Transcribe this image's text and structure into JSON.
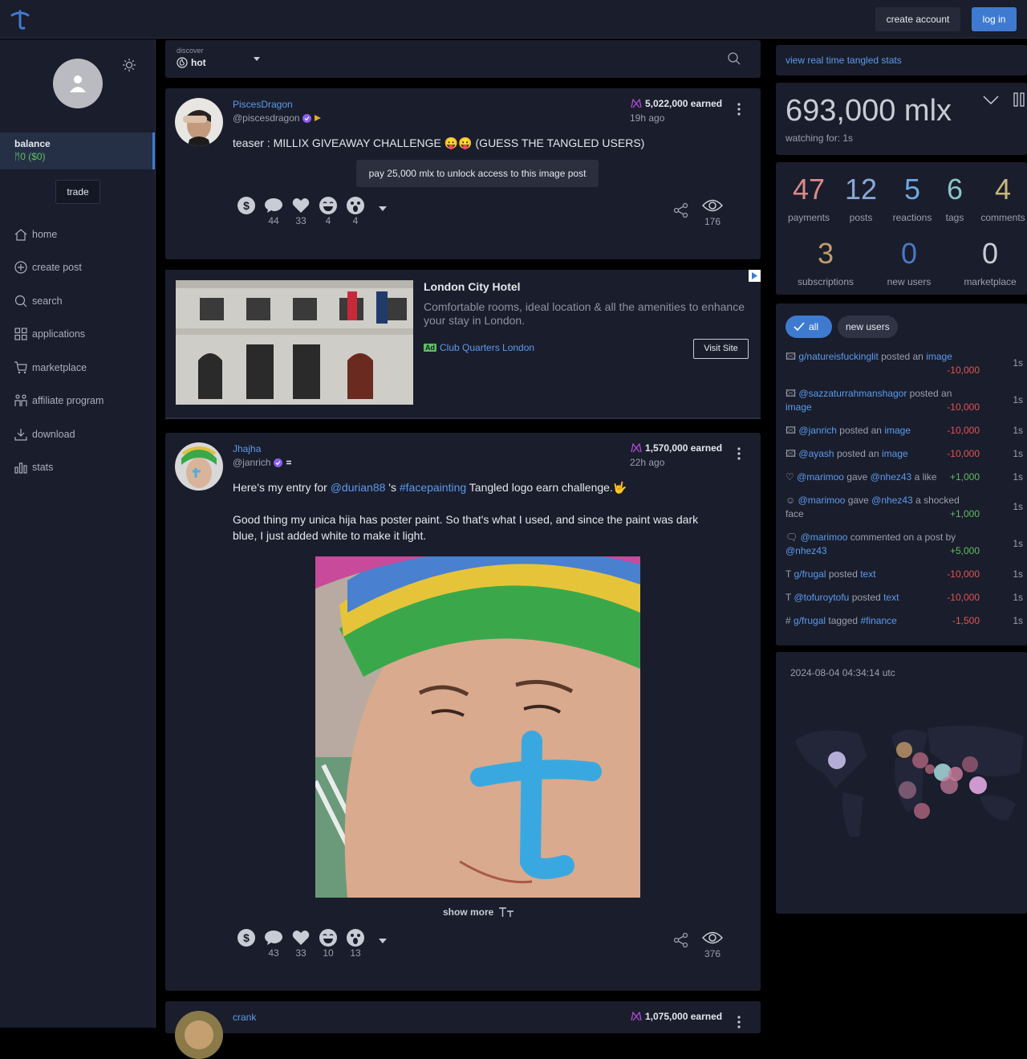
{
  "topbar": {
    "create_account": "create account",
    "log_in": "log in"
  },
  "sidebar": {
    "balance_label": "balance",
    "balance_value": "0 ($0)",
    "trade": "trade",
    "nav": [
      {
        "icon": "home-icon",
        "label": "home"
      },
      {
        "icon": "plus-circle-icon",
        "label": "create post"
      },
      {
        "icon": "search-icon",
        "label": "search"
      },
      {
        "icon": "grid-icon",
        "label": "applications"
      },
      {
        "icon": "cart-icon",
        "label": "marketplace"
      },
      {
        "icon": "people-icon",
        "label": "affiliate program"
      },
      {
        "icon": "download-icon",
        "label": "download"
      },
      {
        "icon": "stats-icon",
        "label": "stats"
      }
    ]
  },
  "feed": {
    "discover_label": "discover",
    "sort": "hot",
    "posts": [
      {
        "name": "PiscesDragon",
        "handle": "@piscesdragon",
        "earned": "5,022,000 earned",
        "ago": "19h ago",
        "text": "teaser : MILLIX GIVEAWAY CHALLENGE 😛😛 (GUESS THE TANGLED USERS)",
        "unlock": "pay 25,000 mlx to unlock access to this image post",
        "counts": [
          "44",
          "33",
          "4",
          "4"
        ],
        "views": "176"
      },
      {
        "name": "Jhajha",
        "handle": "@janrich",
        "earned": "1,570,000 earned",
        "ago": "22h ago",
        "line1_a": "Here's my entry for ",
        "line1_mention": "@durian88",
        "line1_b": " 's ",
        "line1_tag": "#facepainting",
        "line1_c": " Tangled logo earn challenge.🤟",
        "line2": "Good thing my unica hija has poster paint. So that's what I used, and since the paint was dark blue, I just added white to make it light.",
        "show_more": "show more",
        "counts": [
          "43",
          "33",
          "10",
          "13"
        ],
        "views": "376"
      },
      {
        "name": "crank",
        "earned": "1,075,000 earned"
      }
    ]
  },
  "ad": {
    "title": "London City Hotel",
    "desc": "Comfortable rooms, ideal location & all the amenities to enhance your stay in London.",
    "tag": "Ad",
    "advertiser": "Club Quarters London",
    "visit": "Visit Site"
  },
  "right": {
    "stats_link": "view real time tangled stats",
    "total": "693,000 mlx",
    "watching": "watching for: 1s",
    "stats": [
      {
        "n": "47",
        "l": "payments",
        "color": "#d98a8a"
      },
      {
        "n": "12",
        "l": "posts",
        "color": "#8aa8d9"
      },
      {
        "n": "5",
        "l": "reactions",
        "color": "#6fa8e0"
      },
      {
        "n": "6",
        "l": "tags",
        "color": "#8ac4c4"
      },
      {
        "n": "4",
        "l": "comments",
        "color": "#c4b87a"
      },
      {
        "n": "3",
        "l": "subscriptions",
        "color": "#c49a6a"
      },
      {
        "n": "0",
        "l": "new users",
        "color": "#4a78c4"
      },
      {
        "n": "0",
        "l": "marketplace",
        "color": "#c9ccd4"
      }
    ],
    "filter_all": "all",
    "filter_new": "new users",
    "activity": [
      {
        "a": "g/natureisfuckinglit",
        "m": " posted an ",
        "b": "image",
        "amt": "-10,000",
        "t": "1s"
      },
      {
        "a": "@sazzaturrahmanshagor",
        "m": " posted an ",
        "b": "image",
        "amt": "-10,000",
        "t": "1s"
      },
      {
        "a": "@janrich",
        "m": " posted an ",
        "b": "image",
        "amt": "-10,000",
        "t": "1s"
      },
      {
        "a": "@ayash",
        "m": " posted an ",
        "b": "image",
        "amt": "-10,000",
        "t": "1s"
      },
      {
        "a": "@marimoo",
        "m": " gave ",
        "b": "@nhez43",
        "c": " a like",
        "amt": "+1,000",
        "t": "1s"
      },
      {
        "a": "@marimoo",
        "m": " gave ",
        "b": "@nhez43",
        "c": " a shocked face",
        "amt": "+1,000",
        "t": "1s"
      },
      {
        "a": "@marimoo",
        "m": " commented on a post by ",
        "b": "@nhez43",
        "amt": "+5,000",
        "t": "1s"
      },
      {
        "a": "g/frugal",
        "m": " posted ",
        "b": "text",
        "amt": "-10,000",
        "t": "1s"
      },
      {
        "a": "@tofuroytofu",
        "m": " posted ",
        "b": "text",
        "amt": "-10,000",
        "t": "1s"
      },
      {
        "a": "g/frugal",
        "m": " tagged ",
        "b": "#finance",
        "amt": "-1,500",
        "t": "1s"
      }
    ],
    "timestamp": "2024-08-04 04:34:14 utc"
  }
}
